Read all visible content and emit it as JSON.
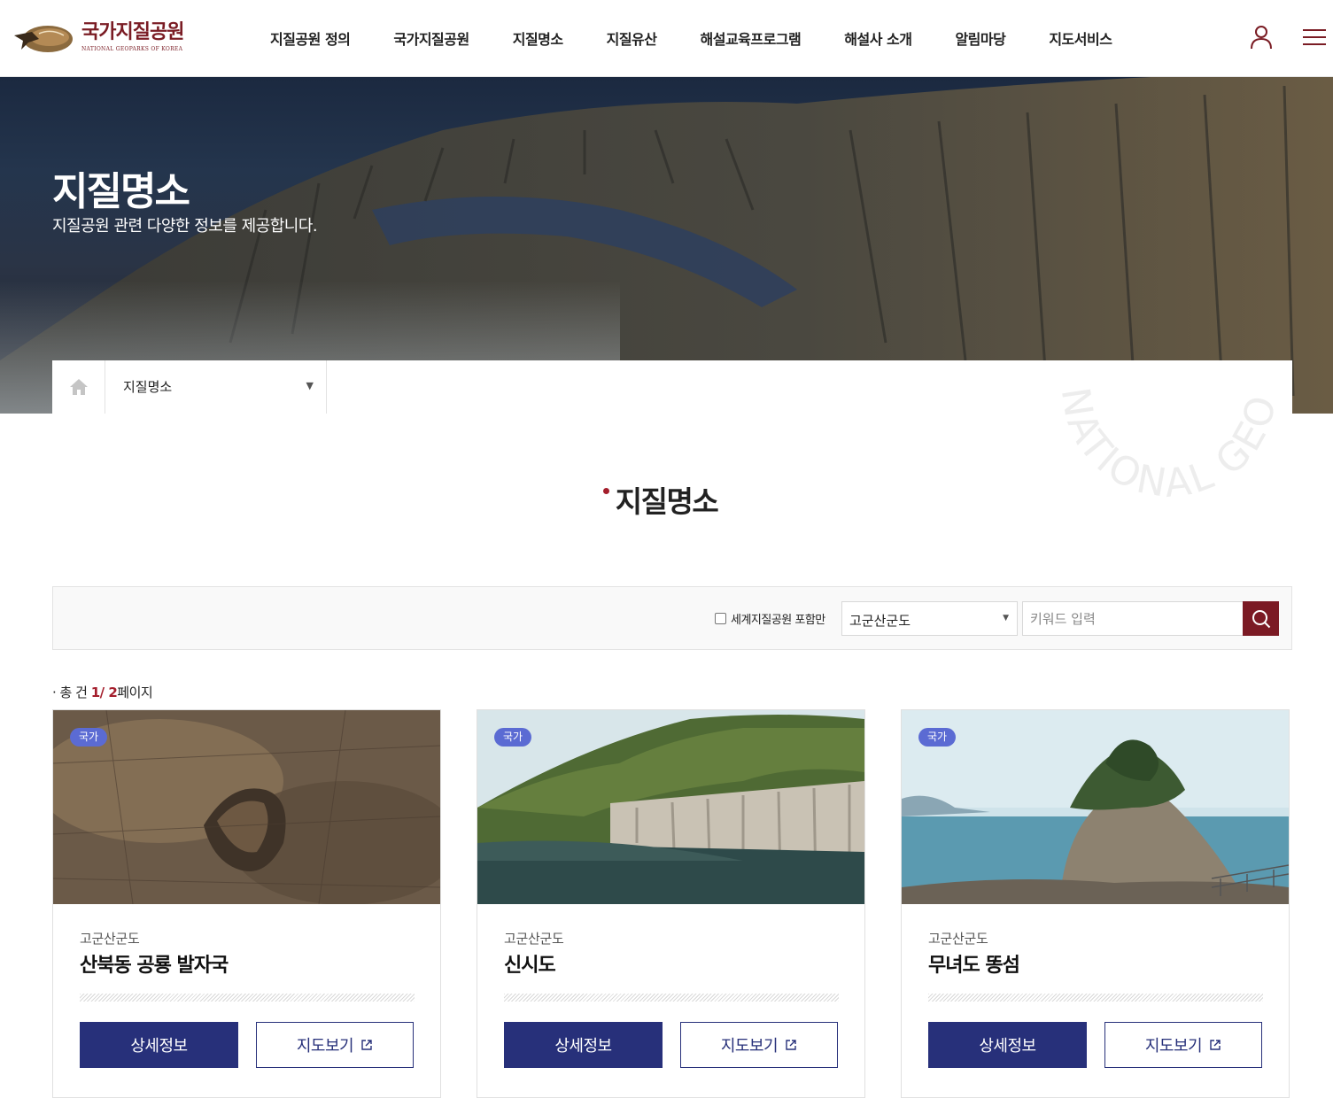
{
  "logo": {
    "ko": "국가지질공원",
    "en": "NATIONAL GEOPARKS OF KOREA"
  },
  "gnb": [
    "지질공원 정의",
    "국가지질공원",
    "지질명소",
    "지질유산",
    "해설교육프로그램",
    "해설사 소개",
    "알림마당",
    "지도서비스"
  ],
  "hero": {
    "title": "지질명소",
    "subtitle": "지질공원 관련 다양한 정보를 제공합니다."
  },
  "breadcrumb": {
    "current": "지질명소",
    "arrow": "▼"
  },
  "section": {
    "title": "지질명소",
    "watermark": "NATIONAL GEOPARKS OF KOREA"
  },
  "search": {
    "checkbox_label": "세계지질공원 포함만",
    "region_selected": "고군산군도",
    "region_arrow": "▼",
    "keyword_placeholder": "키워드 입력"
  },
  "count": {
    "prefix": "· 총 건 ",
    "current_page": "1",
    "sep": "/ ",
    "total_pages": "2",
    "suffix": "페이지"
  },
  "cards": [
    {
      "badge": "국가",
      "region": "고군산군도",
      "title": "산북동 공룡 발자국",
      "detail_label": "상세정보",
      "map_label": "지도보기"
    },
    {
      "badge": "국가",
      "region": "고군산군도",
      "title": "신시도",
      "detail_label": "상세정보",
      "map_label": "지도보기"
    },
    {
      "badge": "국가",
      "region": "고군산군도",
      "title": "무녀도 똥섬",
      "detail_label": "상세정보",
      "map_label": "지도보기"
    }
  ],
  "colors": {
    "brand": "#7a1c24",
    "accent_red": "#a41e2c",
    "button_navy": "#27307a",
    "badge": "#5b6bd3"
  }
}
